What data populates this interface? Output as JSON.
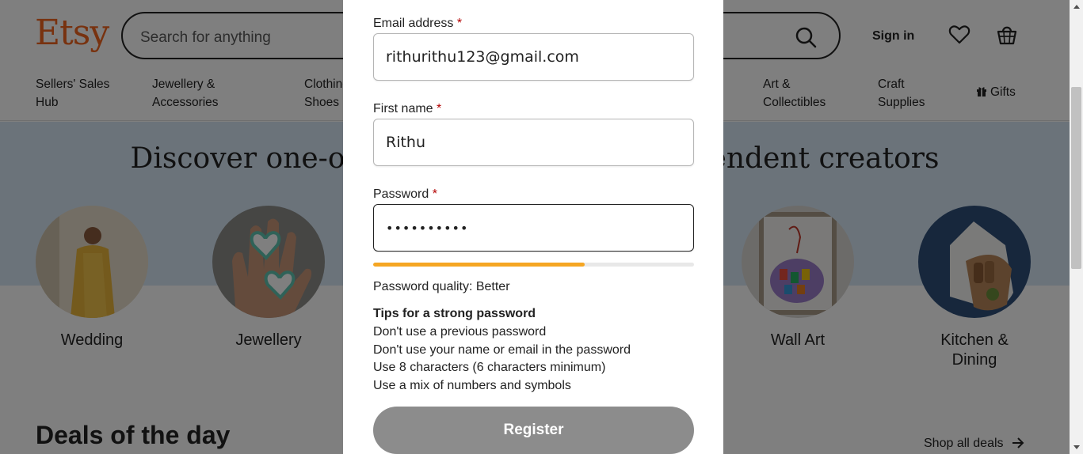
{
  "header": {
    "logo": "Etsy",
    "search_placeholder": "Search for anything",
    "sign_in": "Sign in"
  },
  "categories": [
    {
      "line1": "Sellers' Sales",
      "line2": "Hub"
    },
    {
      "line1": "Jewellery &",
      "line2": "Accessories"
    },
    {
      "line1": "Clothing &",
      "line2": "Shoes"
    },
    {
      "line1": "Art &",
      "line2": "Collectibles"
    },
    {
      "line1": "Craft",
      "line2": "Supplies"
    },
    {
      "line1": "Gifts",
      "line2": ""
    }
  ],
  "hero": {
    "title": "Discover one-of-a-kind items from independent creators"
  },
  "circles": [
    {
      "label": "Wedding"
    },
    {
      "label": "Jewellery"
    },
    {
      "label": "Wall Art"
    },
    {
      "label": "Kitchen &",
      "label2": "Dining"
    }
  ],
  "deals": {
    "title": "Deals of the day",
    "shop_all": "Shop all deals"
  },
  "modal": {
    "email_label": "Email address",
    "email_value": "rithurithu123@gmail.com",
    "first_name_label": "First name",
    "first_name_value": "Rithu",
    "password_label": "Password",
    "password_value": "••••••••••",
    "required_mark": "*",
    "strength_fraction": 0.66,
    "strength_color": "#f5a623",
    "quality_text": "Password quality: Better",
    "tips_heading": "Tips for a strong password",
    "tips": [
      "Don't use a previous password",
      "Don't use your name or email in the password",
      "Use 8 characters (6 characters minimum)",
      "Use a mix of numbers and symbols"
    ],
    "register_label": "Register"
  },
  "colors": {
    "brand": "#f1641e",
    "hero_bg": "#d7e6f5",
    "register_bg": "#8c8c8c"
  }
}
